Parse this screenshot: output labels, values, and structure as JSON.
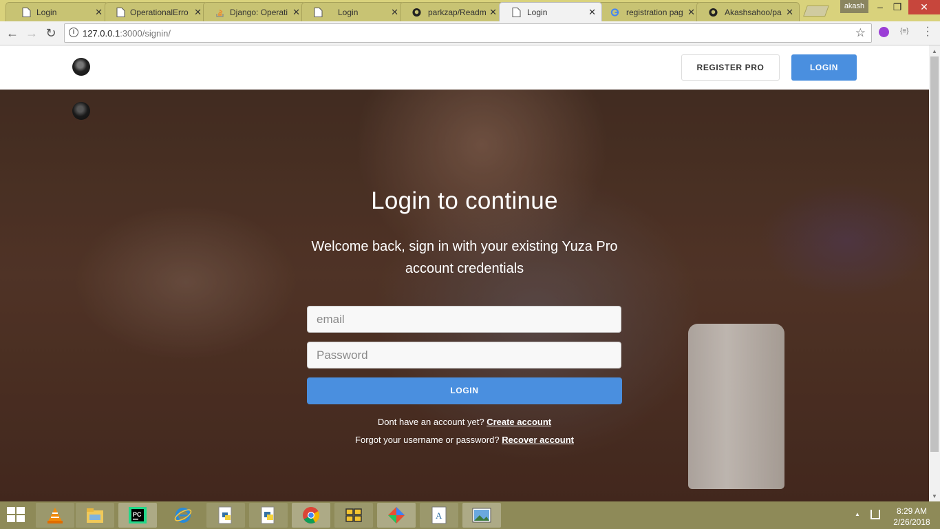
{
  "browser": {
    "tabs": [
      {
        "title": "Login",
        "icon": "page-icon"
      },
      {
        "title": "OperationalErro",
        "icon": "page-icon"
      },
      {
        "title": "Django: Operati",
        "icon": "stackoverflow-icon"
      },
      {
        "title": "Login",
        "icon": "page-icon"
      },
      {
        "title": "parkzap/Readm",
        "icon": "github-icon"
      },
      {
        "title": "Login",
        "icon": "page-icon",
        "active": true
      },
      {
        "title": "registration pag",
        "icon": "google-icon"
      },
      {
        "title": "Akashsahoo/pa",
        "icon": "github-icon"
      }
    ],
    "profile_name": "akash",
    "url_host": "127.0.0.1",
    "url_rest": ":3000/signin/",
    "ext_label": "{≡}"
  },
  "header": {
    "register_label": "REGISTER PRO",
    "login_label": "LOGIN"
  },
  "hero": {
    "headline": "Login to continue",
    "subline": "Welcome back, sign in with your existing Yuza Pro account credentials",
    "email_placeholder": "email",
    "password_placeholder": "Password",
    "login_button": "LOGIN",
    "signup_text": "Dont have an account yet?",
    "signup_link": "Create account",
    "recover_text": "Forgot your username or password?",
    "recover_link": "Recover account"
  },
  "taskbar": {
    "time": "8:29 AM",
    "date": "2/26/2018",
    "apps": [
      "vlc-icon",
      "file-explorer-icon",
      "pycharm-icon",
      "internet-explorer-icon",
      "python-file-icon",
      "python-icon",
      "chrome-icon",
      "app-icon",
      "git-icon",
      "text-editor-icon",
      "photos-icon"
    ]
  },
  "colors": {
    "accent": "#4a8fdf",
    "tabstrip": "#d9d27c",
    "taskbar": "#8e8a58"
  }
}
